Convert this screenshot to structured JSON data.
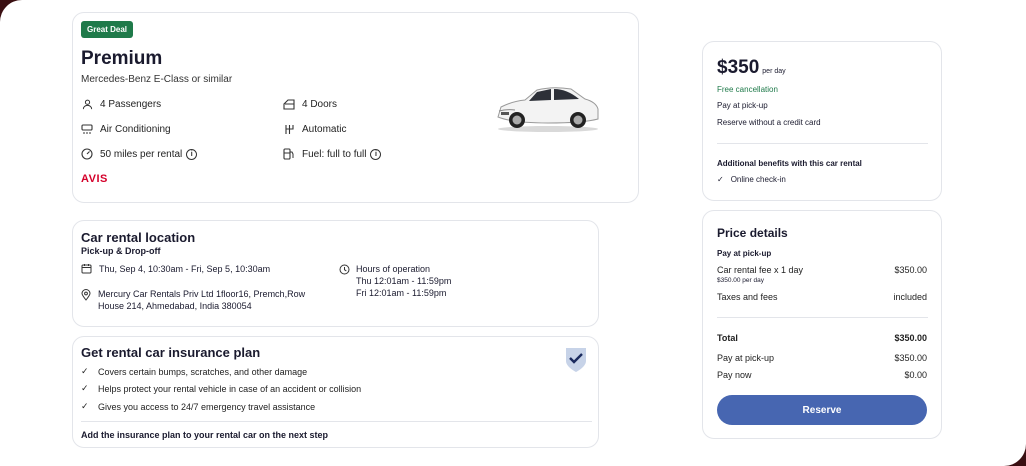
{
  "main": {
    "badge": "Great Deal",
    "title": "Premium",
    "subtitle": "Mercedes-Benz E-Class or similar",
    "features": {
      "passengers": "4 Passengers",
      "doors": "4 Doors",
      "ac": "Air Conditioning",
      "transmission": "Automatic",
      "miles": "50 miles per rental",
      "fuel": "Fuel: full to full"
    },
    "brand": "AVIS"
  },
  "location": {
    "title": "Car rental location",
    "subtitle": "Pick-up & Drop-off",
    "dates": "Thu, Sep 4, 10:30am - Fri, Sep 5, 10:30am",
    "address_line1": "Mercury Car Rentals Priv Ltd 1floor16, Premch,Row",
    "address_line2": "House 214, Ahmedabad, India 380054",
    "hours_title": "Hours of operation",
    "hours_thu": "Thu 12:01am - 11:59pm",
    "hours_fri": "Fri 12:01am - 11:59pm"
  },
  "insurance": {
    "title": "Get rental car insurance plan",
    "items": [
      "Covers certain bumps, scratches, and other damage",
      "Helps protect your rental vehicle in case of an accident or collision",
      "Gives you access to 24/7 emergency travel assistance"
    ],
    "footer": "Add the insurance plan to your rental car on the next step"
  },
  "price": {
    "amount": "$350",
    "per": "per day",
    "free_cancel": "Free cancellation",
    "pay_pickup": "Pay at pick-up",
    "no_card": "Reserve without a credit card",
    "benefits_title": "Additional benefits with this car rental",
    "benefit": "Online check-in"
  },
  "details": {
    "title": "Price details",
    "section": "Pay at pick-up",
    "fee_label": "Car rental fee x 1 day",
    "fee_sub": "$350.00 per day",
    "fee_value": "$350.00",
    "taxes_label": "Taxes and fees",
    "taxes_value": "included",
    "total_label": "Total",
    "total_value": "$350.00",
    "pickup_label": "Pay at pick-up",
    "pickup_value": "$350.00",
    "now_label": "Pay now",
    "now_value": "$0.00",
    "reserve": "Reserve"
  },
  "colors": {
    "badge": "#1f7a4a",
    "free_cancel": "#1f7a4a",
    "brand": "#d4002a",
    "button": "#4766b1",
    "frame": "#3a0f12"
  }
}
